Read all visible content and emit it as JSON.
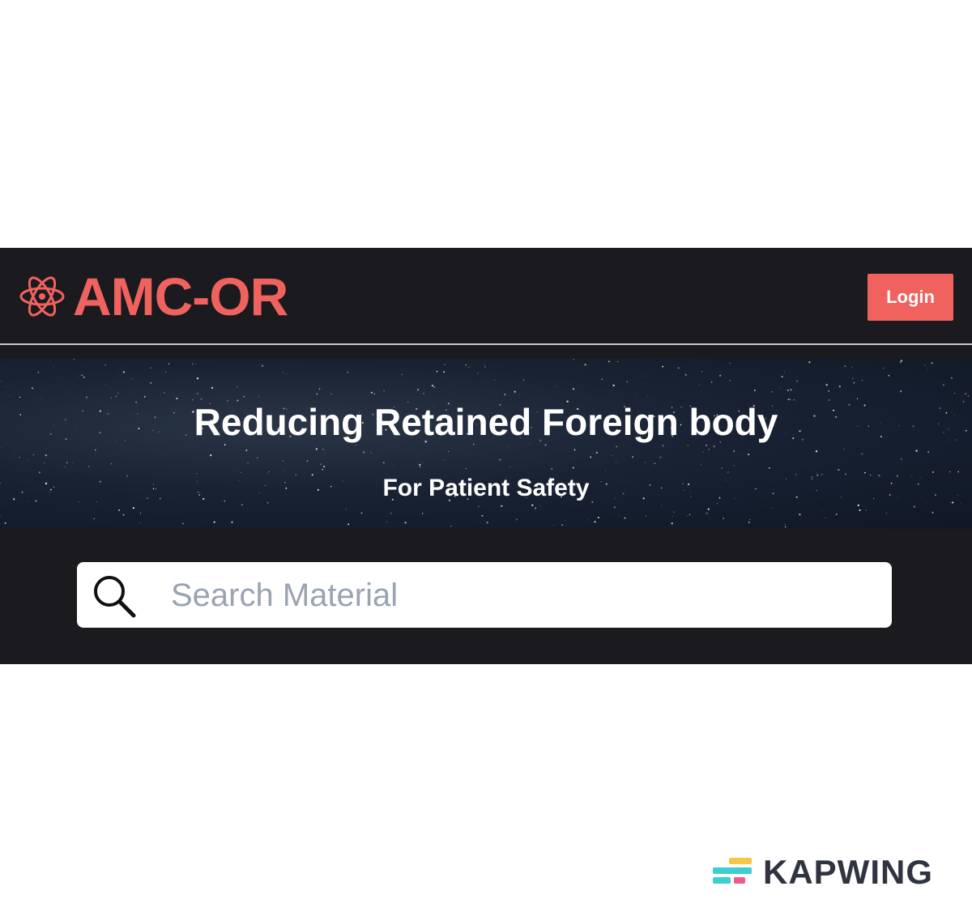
{
  "header": {
    "brand": "AMC-OR",
    "brand_icon": "atom-icon",
    "login_label": "Login",
    "accent_color": "#f0625e"
  },
  "hero": {
    "title": "Reducing Retained Foreign body",
    "subtitle": "For Patient Safety"
  },
  "search": {
    "icon": "search-icon",
    "placeholder": "Search Material",
    "value": ""
  },
  "watermark": {
    "text": "KAPWING",
    "icon": "kapwing-logo-icon"
  }
}
